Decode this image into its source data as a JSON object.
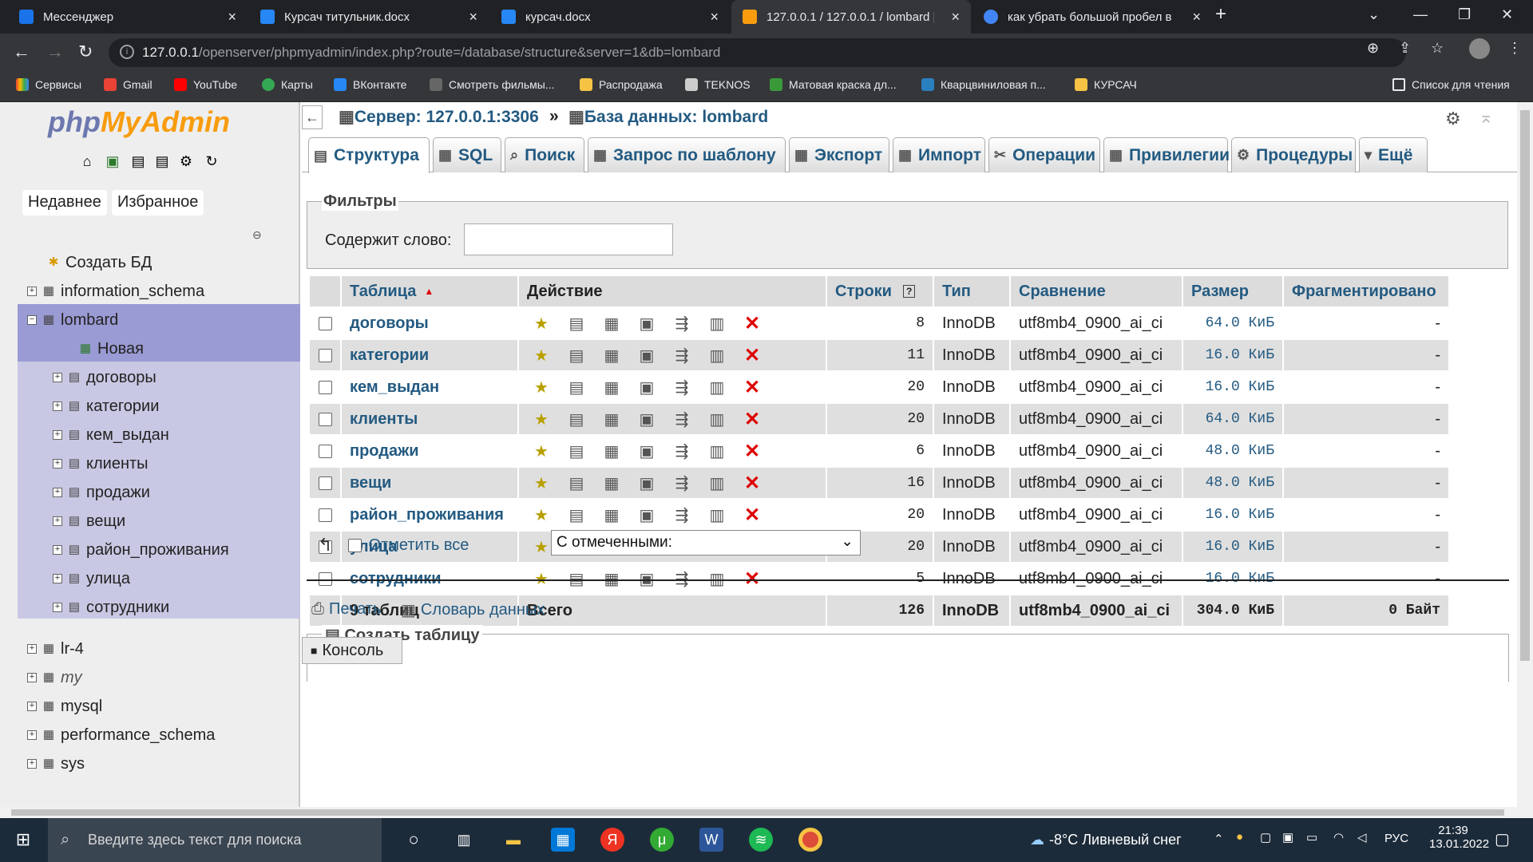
{
  "browser": {
    "tabs": [
      {
        "label": "Мессенджер",
        "color": "#1a73e8"
      },
      {
        "label": "Курсач титульник.docx",
        "color": "#2787f5"
      },
      {
        "label": "курсач.docx",
        "color": "#2787f5"
      },
      {
        "label": "127.0.0.1 / 127.0.0.1 / lombard | ...",
        "color": "#f89c0e"
      },
      {
        "label": "как убрать большой пробел в ...",
        "color": "#4285f4"
      }
    ],
    "new_tab": "+",
    "url_host": "127.0.0.1",
    "url_path": "/openserver/phpmyadmin/index.php?route=/database/structure&server=1&db=lombard",
    "bookmarks": [
      {
        "label": "Сервисы"
      },
      {
        "label": "Gmail"
      },
      {
        "label": "YouTube"
      },
      {
        "label": "Карты"
      },
      {
        "label": "ВКонтакте"
      },
      {
        "label": "Смотреть фильмы..."
      },
      {
        "label": "Распродажа"
      },
      {
        "label": "TEKNOS"
      },
      {
        "label": "Матовая краска дл..."
      },
      {
        "label": "Кварцвиниловая п..."
      },
      {
        "label": "КУРСАЧ"
      }
    ],
    "reading_list": "Список для чтения"
  },
  "nav": {
    "logo_php": "php",
    "logo_myadmin": "MyAdmin",
    "recent": "Недавнее",
    "favorites": "Избранное",
    "create_db": "Создать БД",
    "databases_top": [
      "information_schema",
      "lombard"
    ],
    "new_item": "Новая",
    "lombard_tables": [
      "договоры",
      "категории",
      "кем_выдан",
      "клиенты",
      "продажи",
      "вещи",
      "район_проживания",
      "улица",
      "сотрудники"
    ],
    "databases_bottom": [
      "lr-4",
      "my",
      "mysql",
      "performance_schema",
      "sys"
    ]
  },
  "breadcrumb": {
    "server": "Сервер: 127.0.0.1:3306",
    "sep": "»",
    "database": "База данных: lombard"
  },
  "tabs": [
    "Структура",
    "SQL",
    "Поиск",
    "Запрос по шаблону",
    "Экспорт",
    "Импорт",
    "Операции",
    "Привилегии",
    "Процедуры",
    "Ещё"
  ],
  "filters": {
    "legend": "Фильтры",
    "label": "Содержит слово:",
    "value": ""
  },
  "table": {
    "headers": [
      "Таблица",
      "Действие",
      "Строки",
      "Тип",
      "Сравнение",
      "Размер",
      "Фрагментировано"
    ],
    "rows": [
      {
        "name": "договоры",
        "rows": "8",
        "type": "InnoDB",
        "collation": "utf8mb4_0900_ai_ci",
        "size": "64.0 КиБ",
        "overhead": "-"
      },
      {
        "name": "категории",
        "rows": "11",
        "type": "InnoDB",
        "collation": "utf8mb4_0900_ai_ci",
        "size": "16.0 КиБ",
        "overhead": "-"
      },
      {
        "name": "кем_выдан",
        "rows": "20",
        "type": "InnoDB",
        "collation": "utf8mb4_0900_ai_ci",
        "size": "16.0 КиБ",
        "overhead": "-"
      },
      {
        "name": "клиенты",
        "rows": "20",
        "type": "InnoDB",
        "collation": "utf8mb4_0900_ai_ci",
        "size": "64.0 КиБ",
        "overhead": "-"
      },
      {
        "name": "продажи",
        "rows": "6",
        "type": "InnoDB",
        "collation": "utf8mb4_0900_ai_ci",
        "size": "48.0 КиБ",
        "overhead": "-"
      },
      {
        "name": "вещи",
        "rows": "16",
        "type": "InnoDB",
        "collation": "utf8mb4_0900_ai_ci",
        "size": "48.0 КиБ",
        "overhead": "-"
      },
      {
        "name": "район_проживания",
        "rows": "20",
        "type": "InnoDB",
        "collation": "utf8mb4_0900_ai_ci",
        "size": "16.0 КиБ",
        "overhead": "-"
      },
      {
        "name": "улица",
        "rows": "20",
        "type": "InnoDB",
        "collation": "utf8mb4_0900_ai_ci",
        "size": "16.0 КиБ",
        "overhead": "-"
      },
      {
        "name": "сотрудники",
        "rows": "5",
        "type": "InnoDB",
        "collation": "utf8mb4_0900_ai_ci",
        "size": "16.0 КиБ",
        "overhead": "-"
      }
    ],
    "footer": {
      "count": "9 таблиц",
      "action": "Всего",
      "rows": "126",
      "type": "InnoDB",
      "collation": "utf8mb4_0900_ai_ci",
      "size": "304.0 КиБ",
      "overhead": "0 Байт"
    }
  },
  "bulk": {
    "check_all": "Отметить все",
    "with_selected": "С отмеченными:"
  },
  "links": {
    "print": "Печать",
    "dictionary": "Словарь данных"
  },
  "create_table": "Создать таблицу",
  "console": "Консоль",
  "taskbar": {
    "search_placeholder": "Введите здесь текст для поиска",
    "weather": "-8°C  Ливневый снег",
    "lang": "РУС",
    "time": "21:39",
    "date": "13.01.2022"
  }
}
